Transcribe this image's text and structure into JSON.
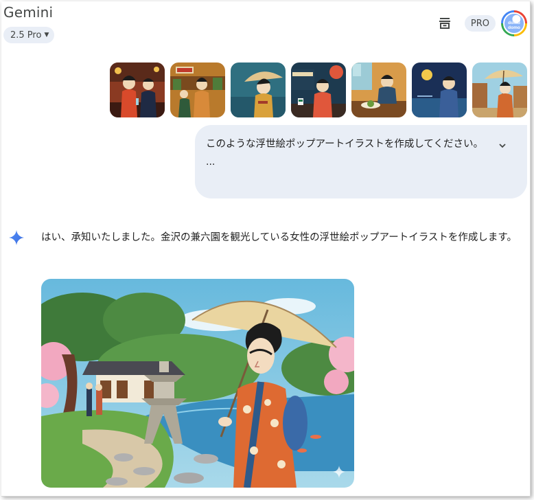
{
  "app": {
    "title": "Gemini",
    "model_label": "2.5 Pro",
    "pro_badge": "PRO",
    "avatar_text_line1": "domo",
    "avatar_text_line2": "domo"
  },
  "icons": {
    "model_caret": "caret-down-icon",
    "temporary_chat": "temporary-chat-icon",
    "expand": "chevron-down-icon",
    "gemini": "gemini-sparkle-icon",
    "image_sparkle": "sparkle-watermark-icon"
  },
  "user_message": {
    "text": "このような浮世絵ポップアートイラストを作成してください。",
    "truncation": "...",
    "attachments": [
      {
        "name": "attachment-bar-scene"
      },
      {
        "name": "attachment-street-shop"
      },
      {
        "name": "attachment-woman-portrait"
      },
      {
        "name": "attachment-starbucks-cafe"
      },
      {
        "name": "attachment-dining-table"
      },
      {
        "name": "attachment-night-moon"
      },
      {
        "name": "attachment-parasol-street"
      }
    ]
  },
  "response": {
    "text": "はい、承知いたしました。金沢の兼六園を観光している女性の浮世絵ポップアートイラストを作成します。"
  },
  "colors": {
    "chip_bg": "#e9eef6",
    "gemini_blue": "#4285f4",
    "text_primary": "#1f1f1f",
    "text_secondary": "#444746"
  }
}
